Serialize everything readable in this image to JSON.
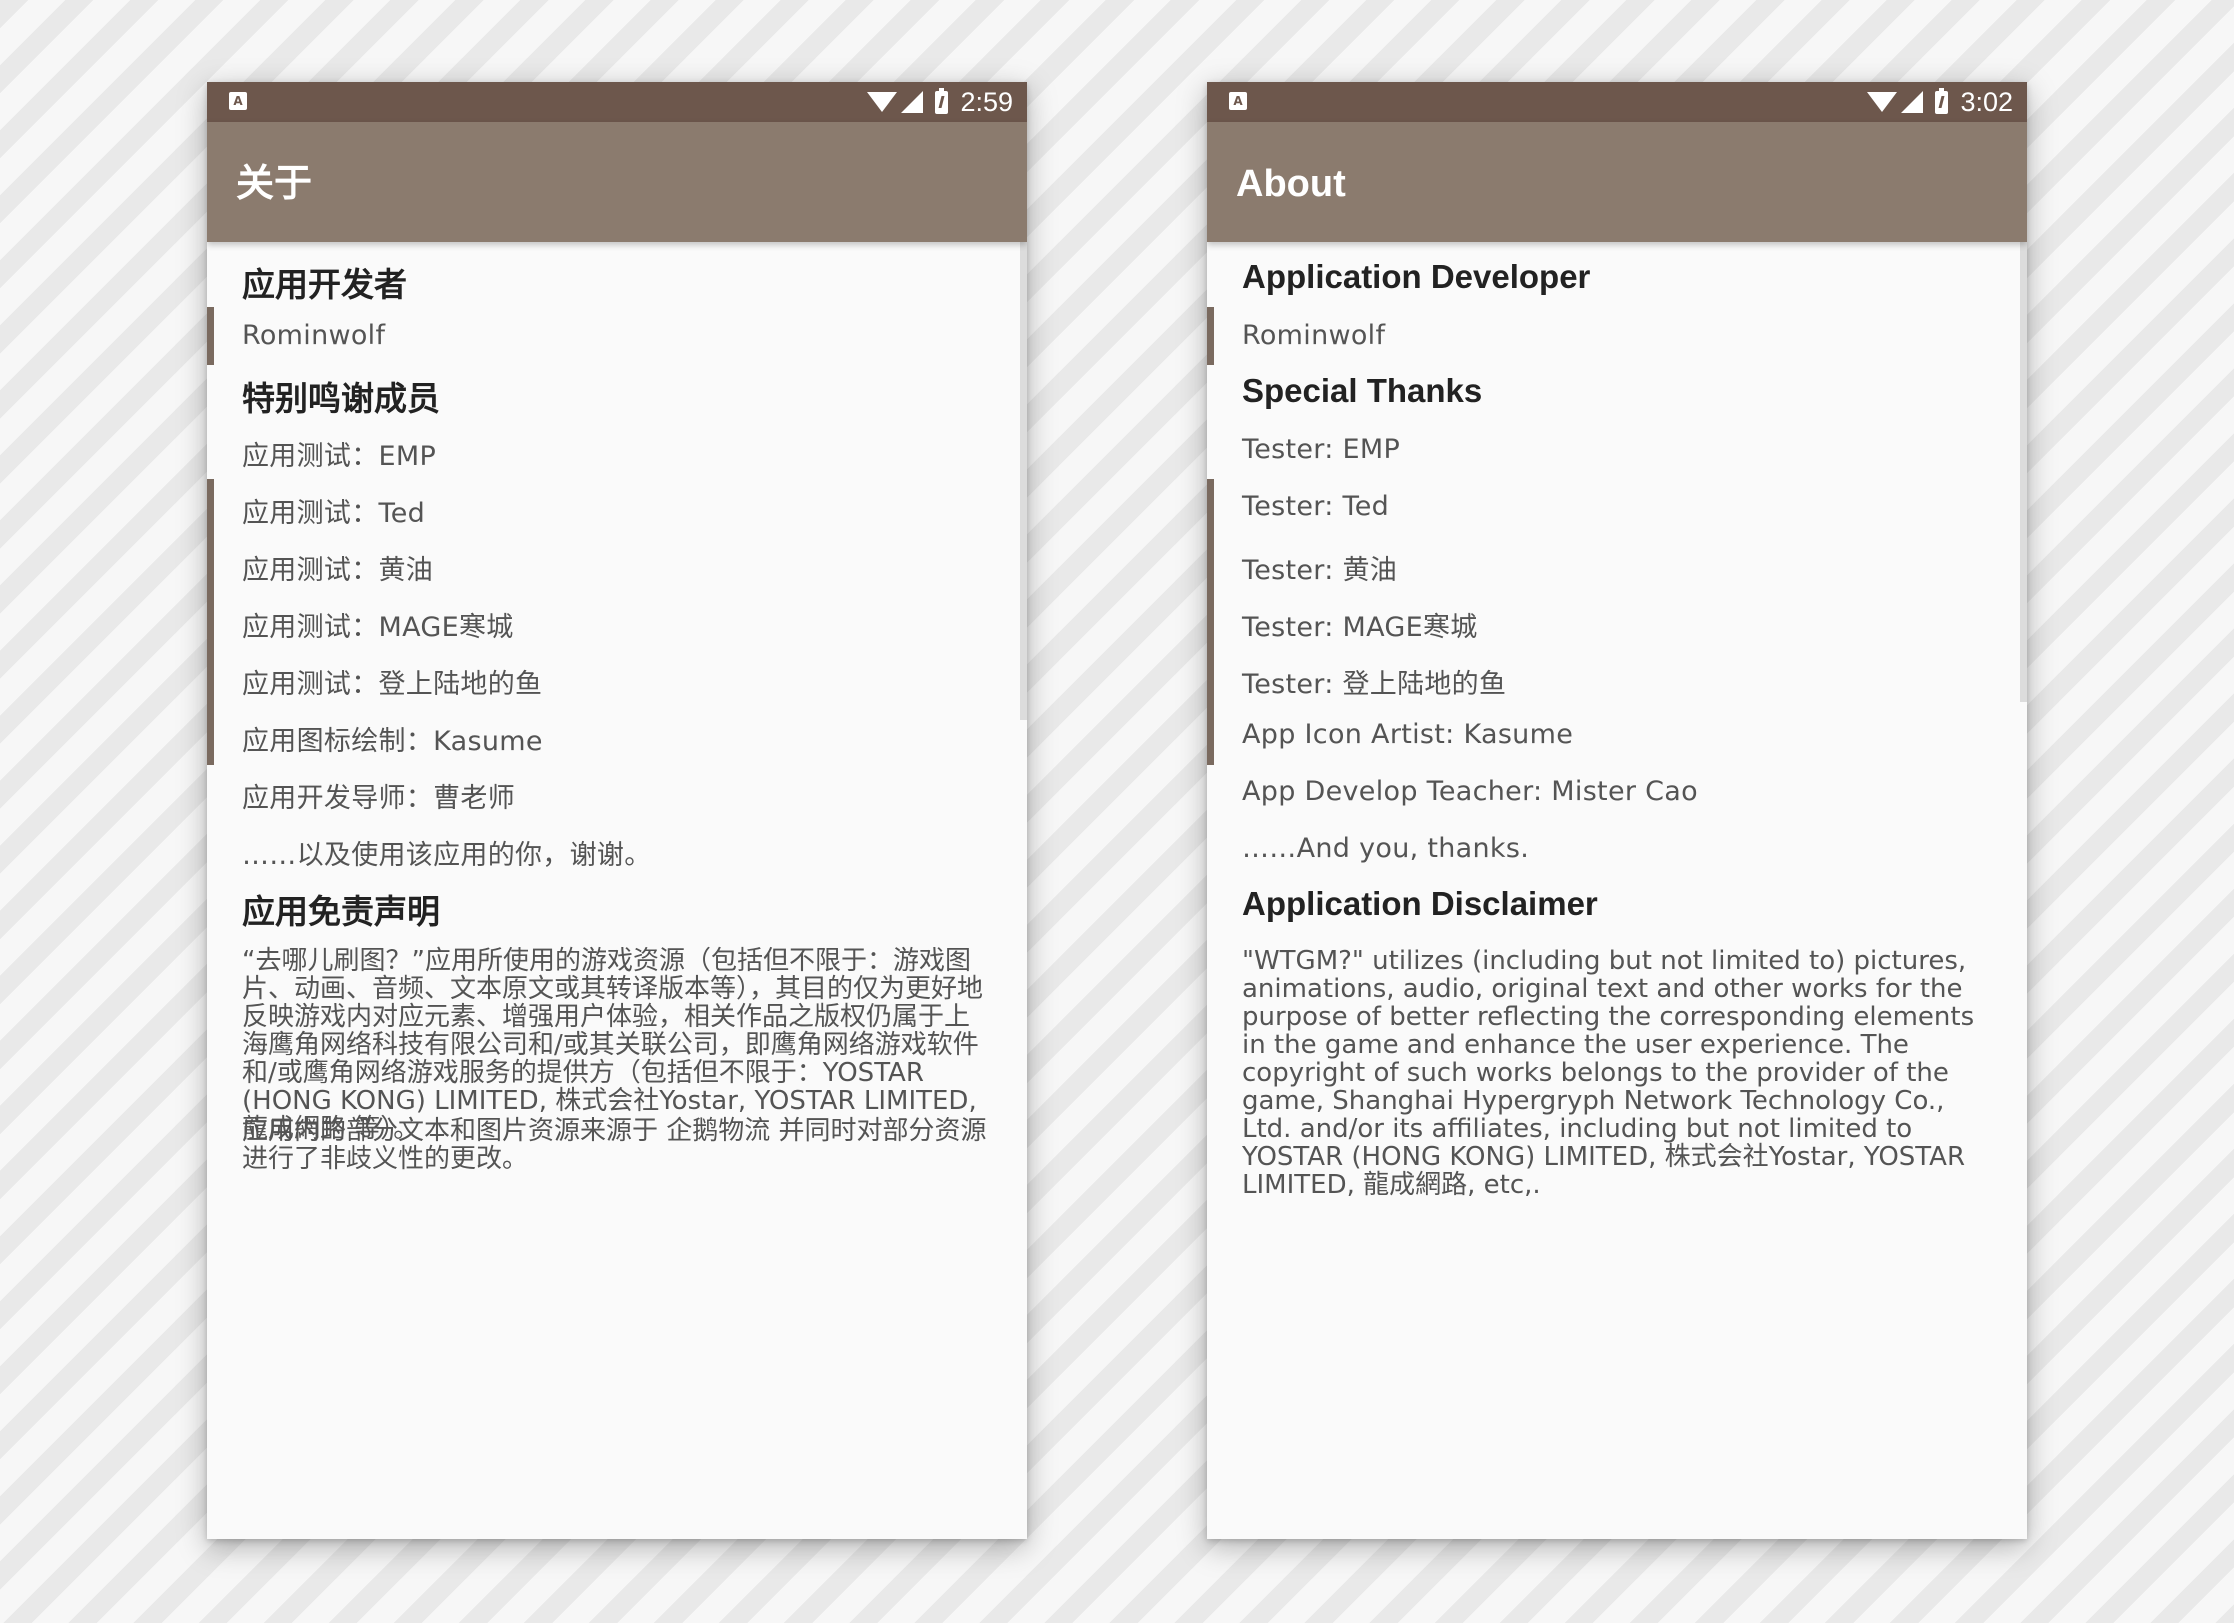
{
  "screens": [
    {
      "status_bar": {
        "notification_icon_letter": "A",
        "time": "2:59"
      },
      "app_bar": {
        "title": "关于"
      },
      "sections": {
        "developer": {
          "title": "应用开发者",
          "items": [
            "Rominwolf"
          ]
        },
        "thanks": {
          "title": "特别鸣谢成员",
          "items": [
            "应用测试：EMP",
            "应用测试：Ted",
            "应用测试：黄油",
            "应用测试：MAGE寒城",
            "应用测试：登上陆地的鱼",
            "应用图标绘制：Kasume",
            "应用开发导师：曹老师",
            "……以及使用该应用的你，谢谢。"
          ]
        },
        "disclaimer": {
          "title": "应用免责声明",
          "paragraphs": [
            "“去哪儿刷图？”应用所使用的游戏资源（包括但不限于：游戏图片、动画、音频、文本原文或其转译版本等），其目的仅为更好地反映游戏内对应元素、增强用户体验，相关作品之版权仍属于上海鹰角网络科技有限公司和/或其关联公司，即鹰角网络游戏软件和/或鹰角网络游戏服务的提供方（包括但不限于：YOSTAR (HONG KONG) LIMITED, 株式会社Yostar, YOSTAR LIMITED, 龍成網路 等）。",
            "应用内的部分文本和图片资源来源于 企鹅物流 并同时对部分资源进行了非歧义性的更改。"
          ]
        }
      }
    },
    {
      "status_bar": {
        "notification_icon_letter": "A",
        "time": "3:02"
      },
      "app_bar": {
        "title": "About"
      },
      "sections": {
        "developer": {
          "title": "Application Developer",
          "items": [
            "Rominwolf"
          ]
        },
        "thanks": {
          "title": "Special Thanks",
          "items": [
            "Tester: EMP",
            "Tester: Ted",
            "Tester: 黄油",
            "Tester: MAGE寒城",
            "Tester: 登上陆地的鱼",
            "App Icon Artist: Kasume",
            "App Develop Teacher: Mister Cao",
            "……And you, thanks."
          ]
        },
        "disclaimer": {
          "title": "Application Disclaimer",
          "paragraphs": [
            "\"WTGM?\" utilizes (including but not limited to) pictures, animations, audio, original text and other works for the purpose of better reflecting the corresponding elements in the game and enhance the user experience. The copyright of such works belongs to the provider of the game, Shanghai Hypergryph Network Technology Co., Ltd. and/or its affiliates, including but not limited to YOSTAR (HONG KONG) LIMITED, 株式会社Yostar, YOSTAR LIMITED, 龍成網路, etc,."
          ]
        }
      }
    }
  ]
}
